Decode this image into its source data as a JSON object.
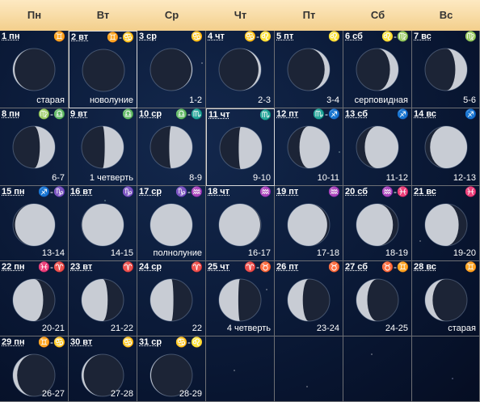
{
  "weekdays": [
    "Пн",
    "Вт",
    "Ср",
    "Чт",
    "Пт",
    "Сб",
    "Вс"
  ],
  "days": [
    {
      "label": "1 пн",
      "zodiac": "♊",
      "phase": "старая",
      "lit": 0.04,
      "waxing": false
    },
    {
      "label": "2 вт",
      "zodiac": "♊-♋",
      "phase": "новолуние",
      "lit": 0.0,
      "waxing": true,
      "highlight": true
    },
    {
      "label": "3 ср",
      "zodiac": "♋",
      "phase": "1-2",
      "lit": 0.02,
      "waxing": true
    },
    {
      "label": "4 чт",
      "zodiac": "♋-♌",
      "phase": "2-3",
      "lit": 0.06,
      "waxing": true
    },
    {
      "label": "5 пт",
      "zodiac": "♌",
      "phase": "3-4",
      "lit": 0.12,
      "waxing": true
    },
    {
      "label": "6 сб",
      "zodiac": "♌-♍",
      "phase": "серповидная",
      "lit": 0.2,
      "waxing": true
    },
    {
      "label": "7 вс",
      "zodiac": "♍",
      "phase": "5-6",
      "lit": 0.28,
      "waxing": true
    },
    {
      "label": "8 пн",
      "zodiac": "♍-♎",
      "phase": "6-7",
      "lit": 0.36,
      "waxing": true
    },
    {
      "label": "9 вт",
      "zodiac": "♎",
      "phase": "1 четверть",
      "lit": 0.45,
      "waxing": true
    },
    {
      "label": "10 ср",
      "zodiac": "♎-♏",
      "phase": "8-9",
      "lit": 0.55,
      "waxing": true
    },
    {
      "label": "11 чт",
      "zodiac": "♏",
      "phase": "9-10",
      "lit": 0.55,
      "waxing": true,
      "highlight": true
    },
    {
      "label": "12 пт",
      "zodiac": "♏-♐",
      "phase": "10-11",
      "lit": 0.72,
      "waxing": true
    },
    {
      "label": "13 сб",
      "zodiac": "♐",
      "phase": "11-12",
      "lit": 0.8,
      "waxing": true
    },
    {
      "label": "14 вс",
      "zodiac": "♐",
      "phase": "12-13",
      "lit": 0.88,
      "waxing": true
    },
    {
      "label": "15 пн",
      "zodiac": "♐-♑",
      "phase": "13-14",
      "lit": 0.95,
      "waxing": true
    },
    {
      "label": "16 вт",
      "zodiac": "♑",
      "phase": "14-15",
      "lit": 0.99,
      "waxing": true
    },
    {
      "label": "17 ср",
      "zodiac": "♑-♒",
      "phase": "полнолуние",
      "lit": 1.0,
      "waxing": true
    },
    {
      "label": "18 чт",
      "zodiac": "♒",
      "phase": "16-17",
      "lit": 0.98,
      "waxing": false
    },
    {
      "label": "19 пт",
      "zodiac": "♒",
      "phase": "17-18",
      "lit": 0.94,
      "waxing": false
    },
    {
      "label": "20 сб",
      "zodiac": "♒-♓",
      "phase": "18-19",
      "lit": 0.87,
      "waxing": false
    },
    {
      "label": "21 вс",
      "zodiac": "♓",
      "phase": "19-20",
      "lit": 0.8,
      "waxing": false
    },
    {
      "label": "22 пн",
      "zodiac": "♓-♈",
      "phase": "20-21",
      "lit": 0.72,
      "waxing": false
    },
    {
      "label": "23 вт",
      "zodiac": "♈",
      "phase": "21-22",
      "lit": 0.62,
      "waxing": false
    },
    {
      "label": "24 ср",
      "zodiac": "♈",
      "phase": "22",
      "lit": 0.55,
      "waxing": false
    },
    {
      "label": "25 чт",
      "zodiac": "♈-♉",
      "phase": "4 четверть",
      "lit": 0.46,
      "waxing": false
    },
    {
      "label": "26 пт",
      "zodiac": "♉",
      "phase": "23-24",
      "lit": 0.36,
      "waxing": false
    },
    {
      "label": "27 сб",
      "zodiac": "♉-♊",
      "phase": "24-25",
      "lit": 0.26,
      "waxing": false
    },
    {
      "label": "28 вс",
      "zodiac": "♊",
      "phase": "старая",
      "lit": 0.18,
      "waxing": false
    },
    {
      "label": "29 пн",
      "zodiac": "♊-♋",
      "phase": "26-27",
      "lit": 0.1,
      "waxing": false
    },
    {
      "label": "30 вт",
      "zodiac": "♋",
      "phase": "27-28",
      "lit": 0.05,
      "waxing": false
    },
    {
      "label": "31 ср",
      "zodiac": "♋-♌",
      "phase": "28-29",
      "lit": 0.02,
      "waxing": false
    }
  ],
  "colors": {
    "moon_lit": "#c8ccd4",
    "moon_dark": "#1c2436",
    "header_text": "#333333"
  }
}
